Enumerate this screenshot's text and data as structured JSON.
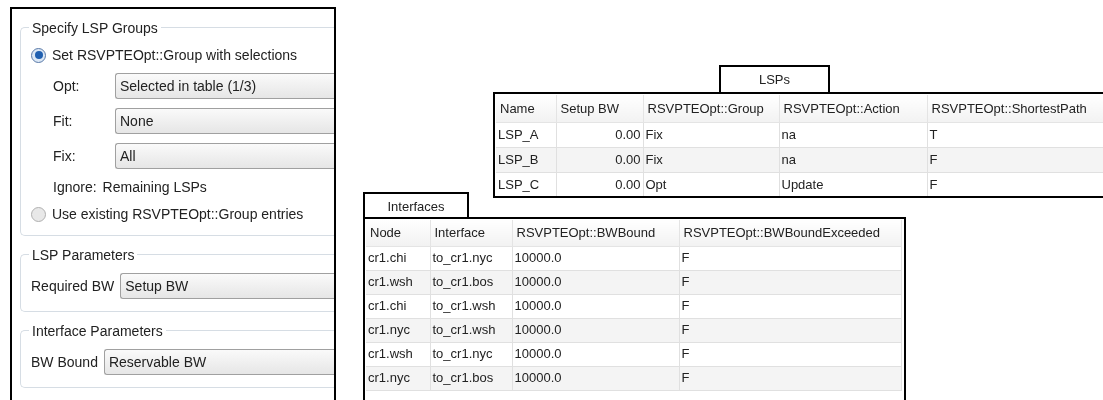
{
  "lsp_groups": {
    "title": "Specify LSP Groups",
    "options": [
      {
        "label": "Set RSVPTEOpt::Group with selections",
        "selected": true
      },
      {
        "label": "Use existing RSVPTEOpt::Group entries",
        "selected": false
      }
    ],
    "fields": [
      {
        "label": "Opt:",
        "value": "Selected in table (1/3)"
      },
      {
        "label": "Fit:",
        "value": "None"
      },
      {
        "label": "Fix:",
        "value": "All"
      }
    ],
    "ignore_label": "Ignore:",
    "ignore_value": "Remaining LSPs"
  },
  "lsp_parameters": {
    "title": "LSP Parameters",
    "field": {
      "label": "Required BW",
      "value": "Setup BW"
    }
  },
  "interface_parameters": {
    "title": "Interface Parameters",
    "field": {
      "label": "BW Bound",
      "value": "Reservable BW"
    }
  },
  "lsps": {
    "title": "LSPs",
    "columns": [
      "Name",
      "Setup BW",
      "RSVPTEOpt::Group",
      "RSVPTEOpt::Action",
      "RSVPTEOpt::ShortestPath"
    ],
    "rows": [
      [
        "LSP_A",
        "0.00",
        "Fix",
        "na",
        "T"
      ],
      [
        "LSP_B",
        "0.00",
        "Fix",
        "na",
        "F"
      ],
      [
        "LSP_C",
        "0.00",
        "Opt",
        "Update",
        "F"
      ]
    ]
  },
  "interfaces": {
    "title": "Interfaces",
    "columns": [
      "Node",
      "Interface",
      "RSVPTEOpt::BWBound",
      "RSVPTEOpt::BWBoundExceeded"
    ],
    "rows": [
      [
        "cr1.chi",
        "to_cr1.nyc",
        "10000.0",
        "F"
      ],
      [
        "cr1.wsh",
        "to_cr1.bos",
        "10000.0",
        "F"
      ],
      [
        "cr1.chi",
        "to_cr1.wsh",
        "10000.0",
        "F"
      ],
      [
        "cr1.nyc",
        "to_cr1.wsh",
        "10000.0",
        "F"
      ],
      [
        "cr1.wsh",
        "to_cr1.nyc",
        "10000.0",
        "F"
      ],
      [
        "cr1.nyc",
        "to_cr1.bos",
        "10000.0",
        "F"
      ]
    ]
  }
}
